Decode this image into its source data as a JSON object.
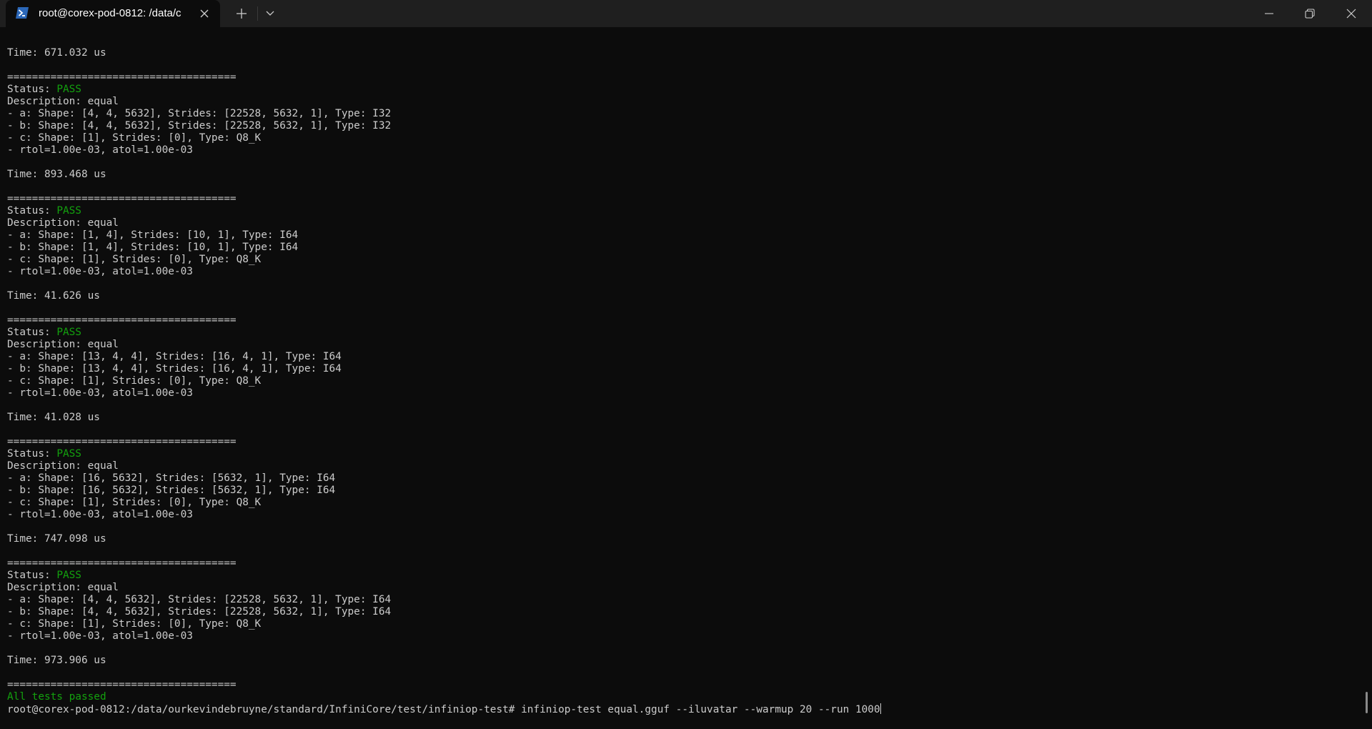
{
  "window": {
    "tab_title": "root@corex-pod-0812: /data/c",
    "tab_icon": "powershell-icon",
    "new_tab_icon": "plus-icon",
    "dropdown_icon": "chevron-down-icon",
    "minimize_icon": "minimize-icon",
    "restore_icon": "restore-icon",
    "close_icon": "close-icon"
  },
  "colors": {
    "background": "#0c0c0c",
    "titlebar": "#1f1f1f",
    "text": "#cccccc",
    "pass": "#13a10e",
    "tab_icon_blue": "#2b67b8"
  },
  "terminal": {
    "lines": [
      {
        "text": "Time: 671.032 us"
      },
      {
        "text": ""
      },
      {
        "text": "====================================="
      },
      {
        "label": "Status: ",
        "status": "PASS"
      },
      {
        "text": "Description: equal"
      },
      {
        "text": "- a: Shape: [4, 4, 5632], Strides: [22528, 5632, 1], Type: I32"
      },
      {
        "text": "- b: Shape: [4, 4, 5632], Strides: [22528, 5632, 1], Type: I32"
      },
      {
        "text": "- c: Shape: [1], Strides: [0], Type: Q8_K"
      },
      {
        "text": "- rtol=1.00e-03, atol=1.00e-03"
      },
      {
        "text": ""
      },
      {
        "text": "Time: 893.468 us"
      },
      {
        "text": ""
      },
      {
        "text": "====================================="
      },
      {
        "label": "Status: ",
        "status": "PASS"
      },
      {
        "text": "Description: equal"
      },
      {
        "text": "- a: Shape: [1, 4], Strides: [10, 1], Type: I64"
      },
      {
        "text": "- b: Shape: [1, 4], Strides: [10, 1], Type: I64"
      },
      {
        "text": "- c: Shape: [1], Strides: [0], Type: Q8_K"
      },
      {
        "text": "- rtol=1.00e-03, atol=1.00e-03"
      },
      {
        "text": ""
      },
      {
        "text": "Time: 41.626 us"
      },
      {
        "text": ""
      },
      {
        "text": "====================================="
      },
      {
        "label": "Status: ",
        "status": "PASS"
      },
      {
        "text": "Description: equal"
      },
      {
        "text": "- a: Shape: [13, 4, 4], Strides: [16, 4, 1], Type: I64"
      },
      {
        "text": "- b: Shape: [13, 4, 4], Strides: [16, 4, 1], Type: I64"
      },
      {
        "text": "- c: Shape: [1], Strides: [0], Type: Q8_K"
      },
      {
        "text": "- rtol=1.00e-03, atol=1.00e-03"
      },
      {
        "text": ""
      },
      {
        "text": "Time: 41.028 us"
      },
      {
        "text": ""
      },
      {
        "text": "====================================="
      },
      {
        "label": "Status: ",
        "status": "PASS"
      },
      {
        "text": "Description: equal"
      },
      {
        "text": "- a: Shape: [16, 5632], Strides: [5632, 1], Type: I64"
      },
      {
        "text": "- b: Shape: [16, 5632], Strides: [5632, 1], Type: I64"
      },
      {
        "text": "- c: Shape: [1], Strides: [0], Type: Q8_K"
      },
      {
        "text": "- rtol=1.00e-03, atol=1.00e-03"
      },
      {
        "text": ""
      },
      {
        "text": "Time: 747.098 us"
      },
      {
        "text": ""
      },
      {
        "text": "====================================="
      },
      {
        "label": "Status: ",
        "status": "PASS"
      },
      {
        "text": "Description: equal"
      },
      {
        "text": "- a: Shape: [4, 4, 5632], Strides: [22528, 5632, 1], Type: I64"
      },
      {
        "text": "- b: Shape: [4, 4, 5632], Strides: [22528, 5632, 1], Type: I64"
      },
      {
        "text": "- c: Shape: [1], Strides: [0], Type: Q8_K"
      },
      {
        "text": "- rtol=1.00e-03, atol=1.00e-03"
      },
      {
        "text": ""
      },
      {
        "text": "Time: 973.906 us"
      },
      {
        "text": ""
      },
      {
        "text": "====================================="
      },
      {
        "summary": "All tests passed"
      }
    ],
    "prompt": "root@corex-pod-0812:/data/ourkevindebruyne/standard/InfiniCore/test/infiniop-test# ",
    "command": "infiniop-test equal.gguf --iluvatar --warmup 20 --run 1000"
  }
}
